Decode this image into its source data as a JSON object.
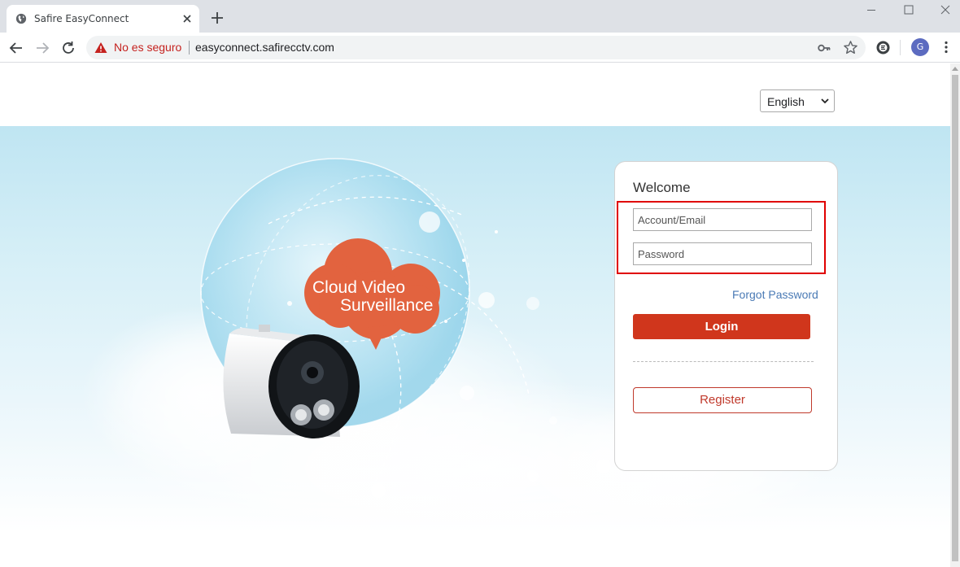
{
  "browser": {
    "tab_title": "Safire EasyConnect",
    "security_label": "No es seguro",
    "url": "easyconnect.safirecctv.com",
    "profile_initial": "G"
  },
  "page": {
    "language": "English",
    "hero": {
      "line1": "Cloud Video",
      "line2": "Surveillance"
    },
    "login": {
      "welcome": "Welcome",
      "account_placeholder": "Account/Email",
      "password_placeholder": "Password",
      "forgot_label": "Forgot Password",
      "login_label": "Login",
      "register_label": "Register"
    }
  },
  "colors": {
    "accent_red": "#d0361c",
    "link_blue": "#4a7ab5",
    "highlight_border": "#e00000",
    "hero_sky": "#bfe5f2"
  }
}
